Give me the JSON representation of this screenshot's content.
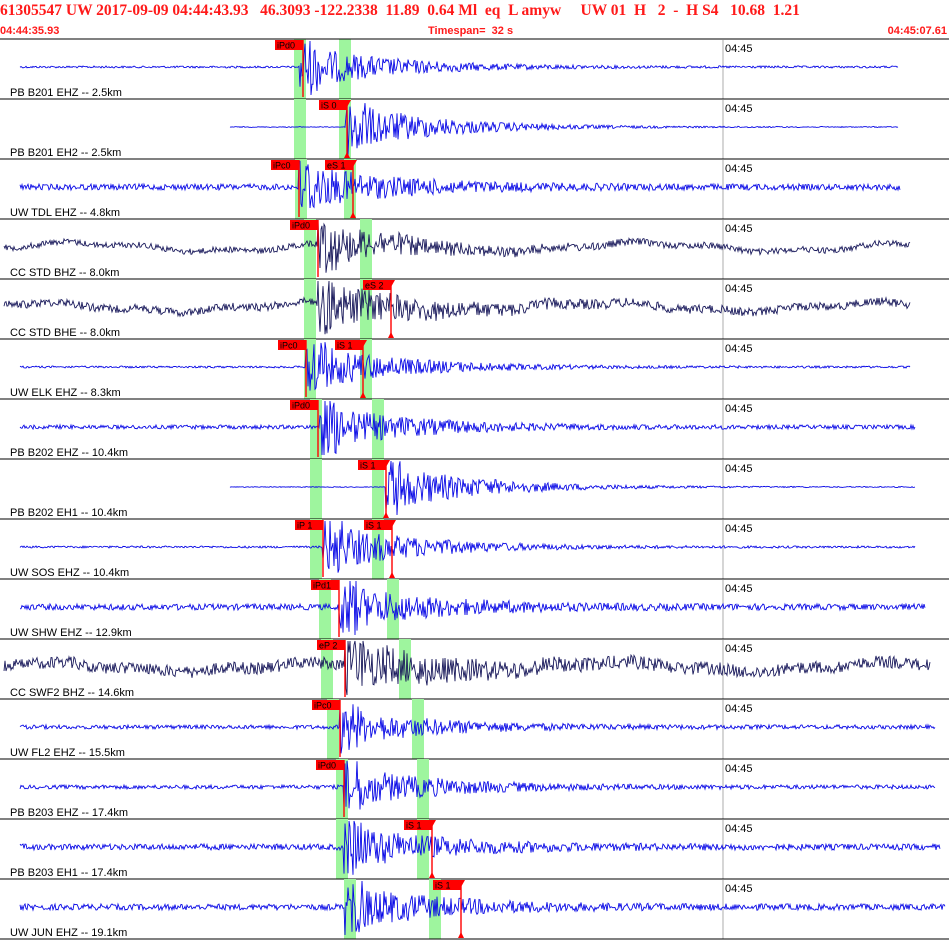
{
  "header": {
    "title": "61305547 UW 2017-09-09 04:44:43.93   46.3093 -122.2338  11.89  0.64 Ml  eq  L amyw     UW 01  H   2  -  H S4   10.68  1.21",
    "time_start": "04:44:35.93",
    "timespan_label": "Timespan=  32 s",
    "time_end": "04:45:07.61"
  },
  "colors": {
    "title": "#ff1a1a",
    "trace_blue": "#0a0ae6",
    "trace_dark": "#1a1a5c",
    "pick": "#ff0000",
    "phase_band": "#9ef59e",
    "separator": "#000000"
  },
  "minute_label": "04:45",
  "traces": [
    {
      "label": "PB B201 EHZ -- 2.5km",
      "color": "blue",
      "pick_p": {
        "label": "iPd0",
        "t": 303
      },
      "pick_s": null,
      "band_p": 300,
      "band_s": 345,
      "onset": 300,
      "end": 898,
      "noise": 1,
      "peak": 22
    },
    {
      "label": "PB B201 EH2 -- 2.5km",
      "color": "blue",
      "pick_p": null,
      "pick_s": {
        "label": "iS 0",
        "t": 347
      },
      "band_p": 300,
      "band_s": 345,
      "onset": 346,
      "end": 898,
      "noise": 0.4,
      "peak": 25
    },
    {
      "label": "UW TDL EHZ -- 4.8km",
      "color": "blue",
      "pick_p": {
        "label": "iPc0",
        "t": 299
      },
      "pick_s": {
        "label": "eS 1",
        "t": 353
      },
      "band_p": 301,
      "band_s": 350,
      "onset": 299,
      "end": 900,
      "noise": 3,
      "peak": 22
    },
    {
      "label": "CC STD BHZ -- 8.0km",
      "color": "dark",
      "pick_p": {
        "label": "iPd0",
        "t": 318
      },
      "pick_s": null,
      "band_p": 310,
      "band_s": 366,
      "onset": 318,
      "end": 910,
      "noise": 3,
      "peak": 20,
      "wavy": true
    },
    {
      "label": "CC STD BHE -- 8.0km",
      "color": "dark",
      "pick_p": null,
      "pick_s": {
        "label": "eS 2",
        "t": 391
      },
      "band_p": 310,
      "band_s": 366,
      "onset": 318,
      "end": 910,
      "noise": 4,
      "peak": 22,
      "wavy": true
    },
    {
      "label": "UW ELK EHZ -- 8.3km",
      "color": "blue",
      "pick_p": {
        "label": "iPc0",
        "t": 306
      },
      "pick_s": {
        "label": "iS 1",
        "t": 363
      },
      "band_p": 310,
      "band_s": 366,
      "onset": 306,
      "end": 910,
      "noise": 1,
      "peak": 24
    },
    {
      "label": "PB B202 EHZ -- 10.4km",
      "color": "blue",
      "pick_p": {
        "label": "iPd0",
        "t": 318
      },
      "pick_s": null,
      "band_p": 316,
      "band_s": 378,
      "onset": 318,
      "end": 915,
      "noise": 2,
      "peak": 22
    },
    {
      "label": "PB B202 EH1 -- 10.4km",
      "color": "blue",
      "pick_p": null,
      "pick_s": {
        "label": "iS 1",
        "t": 386
      },
      "band_p": 316,
      "band_s": 378,
      "onset": 386,
      "end": 915,
      "noise": 0.4,
      "peak": 24
    },
    {
      "label": "UW SOS EHZ -- 10.4km",
      "color": "blue",
      "pick_p": {
        "label": "iP 1",
        "t": 323
      },
      "pick_s": {
        "label": "iS 1",
        "t": 392
      },
      "band_p": 316,
      "band_s": 378,
      "onset": 323,
      "end": 915,
      "noise": 1,
      "peak": 25
    },
    {
      "label": "UW SHW EHZ -- 12.9km",
      "color": "blue",
      "pick_p": {
        "label": "iPd1",
        "t": 339
      },
      "pick_s": null,
      "band_p": 325,
      "band_s": 393,
      "onset": 339,
      "end": 925,
      "noise": 3,
      "peak": 22
    },
    {
      "label": "CC SWF2 BHZ -- 14.6km",
      "color": "dark",
      "pick_p": {
        "label": "eP 2",
        "t": 345
      },
      "pick_s": null,
      "band_p": 327,
      "band_s": 405,
      "onset": 345,
      "end": 930,
      "noise": 6,
      "peak": 22,
      "wavy": true
    },
    {
      "label": "UW FL2 EHZ -- 15.5km",
      "color": "blue",
      "pick_p": {
        "label": "iPc0",
        "t": 340
      },
      "pick_s": null,
      "band_p": 333,
      "band_s": 418,
      "onset": 340,
      "end": 935,
      "noise": 2,
      "peak": 18
    },
    {
      "label": "PB B203 EHZ -- 17.4km",
      "color": "blue",
      "pick_p": {
        "label": "iPd0",
        "t": 344
      },
      "pick_s": null,
      "band_p": 342,
      "band_s": 423,
      "onset": 344,
      "end": 935,
      "noise": 2,
      "peak": 20
    },
    {
      "label": "PB B203 EH1 -- 17.4km",
      "color": "blue",
      "pick_p": null,
      "pick_s": {
        "label": "iS 1",
        "t": 432
      },
      "band_p": 342,
      "band_s": 423,
      "onset": 344,
      "end": 940,
      "noise": 3,
      "peak": 22
    },
    {
      "label": "UW JUN EHZ -- 19.1km",
      "color": "blue",
      "pick_p": null,
      "pick_s": {
        "label": "iS 1",
        "t": 461
      },
      "band_p": 350,
      "band_s": 435,
      "onset": 345,
      "end": 945,
      "noise": 3,
      "peak": 22
    }
  ]
}
